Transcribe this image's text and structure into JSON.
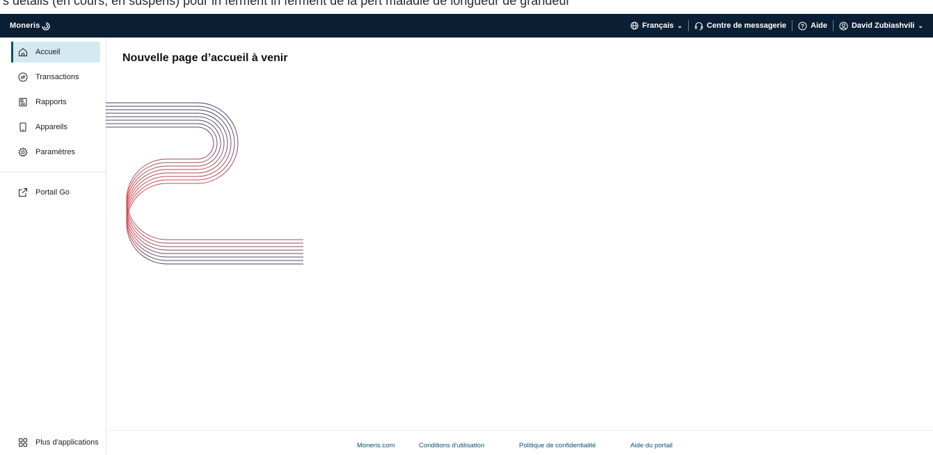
{
  "top_clipped_text": "s détails (en cours, en suspens) pour in ferment in ferment de la pert maladie de longueur de grandeur",
  "header": {
    "logo": "Moneris",
    "language": "Français",
    "message_center": "Centre de messagerie",
    "help": "Aide",
    "user": "David Zubiashvili"
  },
  "sidebar": {
    "items": [
      {
        "label": "Accueil",
        "icon": "home-icon",
        "active": true
      },
      {
        "label": "Transactions",
        "icon": "transactions-icon"
      },
      {
        "label": "Rapports",
        "icon": "reports-icon"
      },
      {
        "label": "Appareils",
        "icon": "device-icon"
      },
      {
        "label": "Paramètres",
        "icon": "gear-icon"
      }
    ],
    "portal": {
      "label": "Portail Go",
      "icon": "external-link-icon"
    },
    "more_apps": {
      "label": "Plus d'applications",
      "icon": "apps-grid-icon"
    }
  },
  "main": {
    "title": "Nouvelle page d’accueil à venir"
  },
  "footer": {
    "links": [
      "Moneris.com",
      "Conditions d'utilisation",
      "Politique de confidentialité",
      "Aide du portail"
    ]
  },
  "colors": {
    "topbar_bg": "#0a1f33",
    "accent": "#0a4f6e",
    "active_bg": "#d5e9f1",
    "deco_red": "#d4474f",
    "deco_navy": "#2e3f66"
  }
}
